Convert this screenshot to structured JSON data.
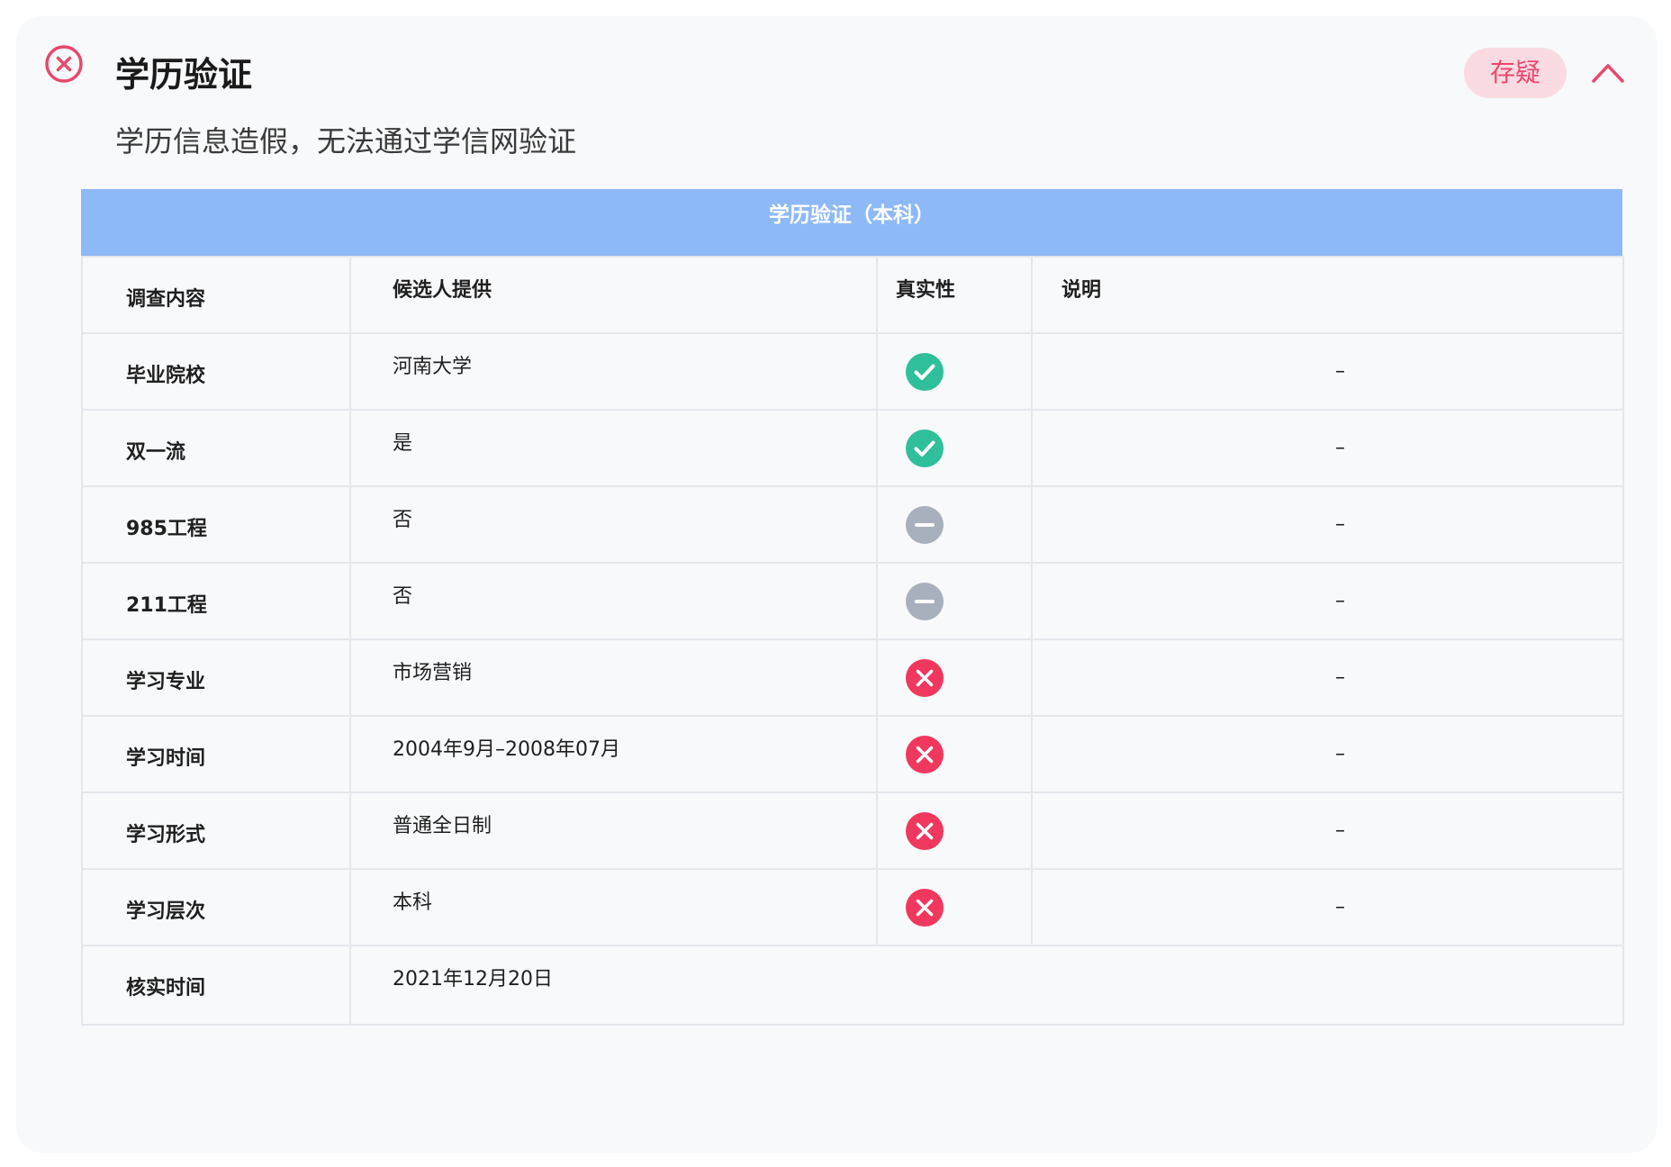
{
  "header": {
    "title": "学历验证",
    "subtitle": "学历信息造假，无法通过学信网验证",
    "badge": "存疑",
    "status_icon": "x-circle-icon",
    "collapse_icon": "chevron-up-icon",
    "colors": {
      "danger": "#e8486c",
      "success": "#2fbf9a",
      "neutral": "#a8b0bd",
      "table_header": "#8db9f7"
    }
  },
  "table": {
    "caption": "学历验证（本科）",
    "columns": [
      "调查内容",
      "候选人提供",
      "真实性",
      "说明"
    ],
    "rows": [
      {
        "item": "毕业院校",
        "provided": "河南大学",
        "authenticity": "check",
        "note": "–"
      },
      {
        "item": "双一流",
        "provided": "是",
        "authenticity": "check",
        "note": "–"
      },
      {
        "item": "985工程",
        "provided": "否",
        "authenticity": "minus",
        "note": "–"
      },
      {
        "item": "211工程",
        "provided": "否",
        "authenticity": "minus",
        "note": "–"
      },
      {
        "item": "学习专业",
        "provided": "市场营销",
        "authenticity": "cross",
        "note": "–"
      },
      {
        "item": "学习时间",
        "provided": "2004年9月–2008年07月",
        "authenticity": "cross",
        "note": "–"
      },
      {
        "item": "学习形式",
        "provided": "普通全日制",
        "authenticity": "cross",
        "note": "–"
      },
      {
        "item": "学习层次",
        "provided": "本科",
        "authenticity": "cross",
        "note": "–"
      }
    ],
    "verified": {
      "label": "核实时间",
      "value": "2021年12月20日"
    }
  }
}
